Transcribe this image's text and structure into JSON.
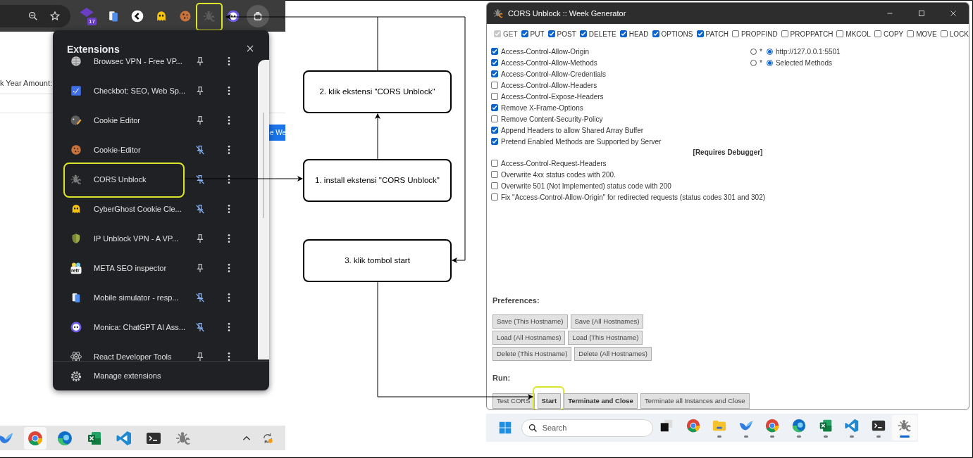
{
  "browser": {
    "toolbar": {
      "extensions": [
        {
          "kind": "calendar",
          "badge": "17",
          "highlighted": false
        },
        {
          "kind": "phone",
          "highlighted": false
        },
        {
          "kind": "back",
          "highlighted": false
        },
        {
          "kind": "ghost",
          "highlighted": false
        },
        {
          "kind": "cookie",
          "highlighted": false
        },
        {
          "kind": "bugdim",
          "highlighted": true
        },
        {
          "kind": "monica",
          "highlighted": false
        }
      ]
    },
    "page": {
      "label": "k Year Amount:",
      "button": "e We"
    },
    "extensions_popup": {
      "title": "Extensions",
      "items": [
        {
          "kind": "globe",
          "name": "Browsec VPN - Free VP...",
          "pinned": false,
          "highlighted": false
        },
        {
          "kind": "checkbot",
          "name": "Checkbot: SEO, Web Sp...",
          "pinned": false,
          "highlighted": false
        },
        {
          "kind": "palette",
          "name": "Cookie Editor",
          "pinned": false,
          "highlighted": false
        },
        {
          "kind": "cookie",
          "name": "Cookie-Editor",
          "pinned": true,
          "highlighted": false
        },
        {
          "kind": "bug",
          "name": "CORS Unblock",
          "pinned": true,
          "highlighted": true
        },
        {
          "kind": "ghost",
          "name": "CyberGhost Cookie Cle...",
          "pinned": true,
          "highlighted": false
        },
        {
          "kind": "shield",
          "name": "IP Unblock VPN - A VP...",
          "pinned": false,
          "highlighted": false
        },
        {
          "kind": "refr",
          "icon_label": "refr",
          "name": "META SEO inspector",
          "pinned": false,
          "highlighted": false
        },
        {
          "kind": "phone",
          "name": "Mobile simulator - resp...",
          "pinned": true,
          "highlighted": false
        },
        {
          "kind": "monica",
          "name": "Monica: ChatGPT AI Ass...",
          "pinned": true,
          "highlighted": false
        },
        {
          "kind": "atom",
          "name": "React Developer Tools",
          "pinned": false,
          "highlighted": false
        }
      ],
      "footer": "Manage extensions"
    },
    "taskbar": [
      {
        "kind": "bird",
        "selected": false
      },
      {
        "kind": "chrome",
        "selected": true
      },
      {
        "kind": "edge",
        "selected": false
      },
      {
        "kind": "excel",
        "selected": false
      },
      {
        "kind": "vscode",
        "selected": false
      },
      {
        "kind": "terminal",
        "selected": false
      },
      {
        "kind": "bug",
        "selected": false
      }
    ],
    "tray": [
      {
        "kind": "caret"
      },
      {
        "kind": "update"
      }
    ]
  },
  "flow": {
    "steps": [
      {
        "label": "2. klik ekstensi \"CORS Unblock\""
      },
      {
        "label": "1. install ekstensi \"CORS Unblock\""
      },
      {
        "label": "3. klik tombol start"
      }
    ]
  },
  "window": {
    "title": "CORS Unblock :: Week Generator",
    "methods": [
      {
        "label": "GET",
        "checked": true,
        "disabled": true
      },
      {
        "label": "PUT",
        "checked": true,
        "disabled": false
      },
      {
        "label": "POST",
        "checked": true,
        "disabled": false
      },
      {
        "label": "DELETE",
        "checked": true,
        "disabled": false
      },
      {
        "label": "HEAD",
        "checked": true,
        "disabled": false
      },
      {
        "label": "OPTIONS",
        "checked": true,
        "disabled": false
      },
      {
        "label": "PATCH",
        "checked": true,
        "disabled": false
      },
      {
        "label": "PROPFIND",
        "checked": false,
        "disabled": false
      },
      {
        "label": "PROPPATCH",
        "checked": false,
        "disabled": false
      },
      {
        "label": "MKCOL",
        "checked": false,
        "disabled": false
      },
      {
        "label": "COPY",
        "checked": false,
        "disabled": false
      },
      {
        "label": "MOVE",
        "checked": false,
        "disabled": false
      },
      {
        "label": "LOCK",
        "checked": false,
        "disabled": false
      }
    ],
    "options": [
      {
        "kind": "option",
        "label": "Access-Control-Allow-Origin",
        "checked": true
      },
      {
        "kind": "option",
        "label": "Access-Control-Allow-Methods",
        "checked": true
      },
      {
        "kind": "option",
        "label": "Access-Control-Allow-Credentials",
        "checked": true
      },
      {
        "kind": "option",
        "label": "Access-Control-Allow-Headers",
        "checked": false
      },
      {
        "kind": "option",
        "label": "Access-Control-Expose-Headers",
        "checked": false
      },
      {
        "kind": "option",
        "label": "Remove X-Frame-Options",
        "checked": true
      },
      {
        "kind": "option",
        "label": "Remove Content-Security-Policy",
        "checked": false
      },
      {
        "kind": "option",
        "label": "Append Headers to allow Shared Array Buffer",
        "checked": true
      },
      {
        "kind": "option",
        "label": "Pretend Enabled Methods are Supported by Server",
        "checked": true
      },
      {
        "kind": "heading",
        "label": "[Requires Debugger]"
      },
      {
        "kind": "option",
        "label": "Access-Control-Request-Headers",
        "checked": false
      },
      {
        "kind": "option",
        "label": "Overwrite 4xx status codes with 200.",
        "checked": false
      },
      {
        "kind": "option",
        "label": "Overwrite 501 (Not Implemented) status code with 200",
        "checked": false
      },
      {
        "kind": "option",
        "label": "Fix \"Access-Control-Allow-Origin\" for redirected requests (status codes 301 and 302)",
        "checked": false
      }
    ],
    "radio_groups": [
      {
        "options": [
          {
            "label": "*",
            "selected": false
          },
          {
            "label": "http://127.0.0.1:5501",
            "selected": true
          }
        ]
      },
      {
        "options": [
          {
            "label": "*",
            "selected": false
          },
          {
            "label": "Selected Methods",
            "selected": true
          }
        ]
      }
    ],
    "preferences": {
      "title": "Preferences:",
      "button_rows": [
        [
          "Save (This Hostname)",
          "Save (All Hostnames)"
        ],
        [
          "Load (All Hostnames)",
          "Load (This Hostname)"
        ],
        [
          "Delete (This Hostname)",
          "Delete (All Hostnames)"
        ]
      ]
    },
    "run": {
      "title": "Run:",
      "buttons": [
        {
          "label": "Test CORS",
          "bold": false,
          "highlighted": false
        },
        {
          "label": "Start",
          "bold": true,
          "highlighted": true
        },
        {
          "label": "Terminate and Close",
          "bold": true,
          "highlighted": false
        },
        {
          "label": "Terminate all Instances and Close",
          "bold": false,
          "highlighted": false
        }
      ]
    },
    "taskbar": {
      "search": {
        "placeholder": "Search"
      },
      "apps": [
        {
          "kind": "taskview",
          "running": false,
          "selected": false
        },
        {
          "kind": "chrome",
          "running": false,
          "selected": false
        },
        {
          "kind": "folder",
          "running": true,
          "selected": false
        },
        {
          "kind": "bird",
          "running": true,
          "selected": false
        },
        {
          "kind": "chrome",
          "running": true,
          "selected": false
        },
        {
          "kind": "edge",
          "running": true,
          "selected": false
        },
        {
          "kind": "excel",
          "running": true,
          "selected": false
        },
        {
          "kind": "vscode",
          "running": true,
          "selected": false
        },
        {
          "kind": "terminal",
          "running": true,
          "selected": false
        },
        {
          "kind": "bug",
          "running": false,
          "selected": true
        }
      ]
    }
  }
}
